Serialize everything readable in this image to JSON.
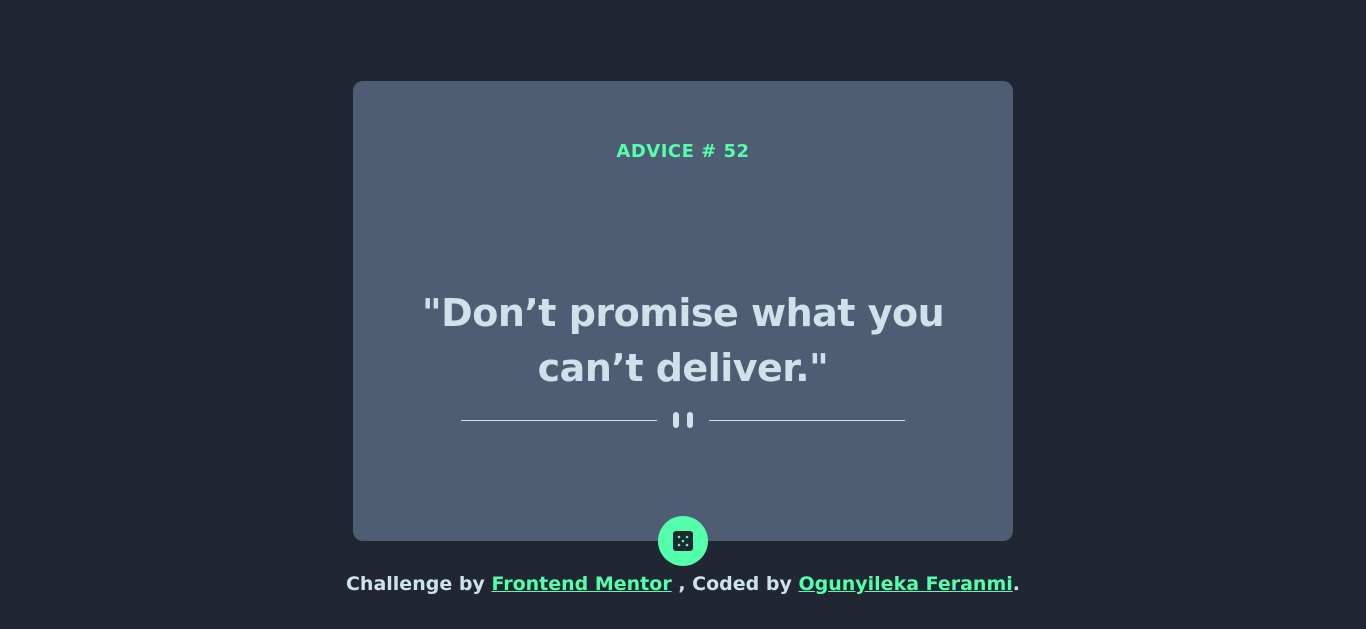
{
  "card": {
    "advice_label": "ADVICE # 52",
    "quote": "\"Don’t promise what you can’t deliver.\""
  },
  "dice_button": {
    "icon": "dice-icon"
  },
  "footer": {
    "challenge_prefix": "Challenge by",
    "challenge_link": "Frontend Mentor",
    "coded_prefix": ", Coded by",
    "coded_link": "Ogunyileka Feranmi",
    "end": "."
  },
  "colors": {
    "background": "#202632",
    "card": "#4f5d74",
    "accent": "#53ffaa",
    "text": "#cee3e9"
  }
}
